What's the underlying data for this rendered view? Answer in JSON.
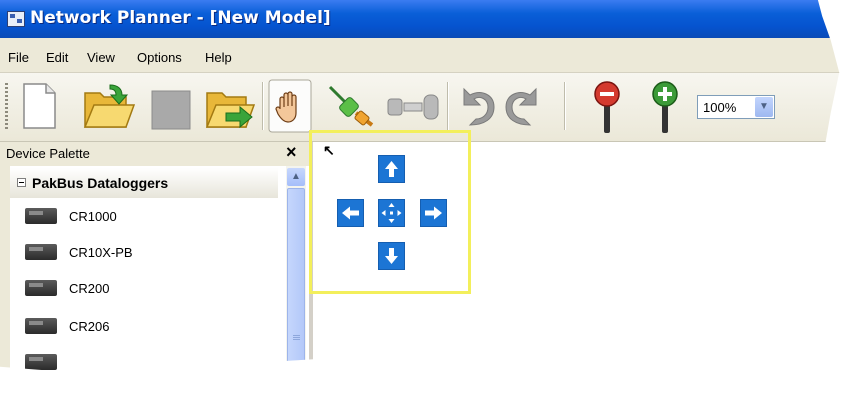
{
  "window": {
    "title": "Network Planner - [New Model]"
  },
  "menu": [
    "File",
    "Edit",
    "View",
    "Options",
    "Help"
  ],
  "toolbar": {
    "buttons": [
      {
        "name": "new-file-icon"
      },
      {
        "name": "open-folder-icon"
      },
      {
        "name": "save-icon"
      },
      {
        "name": "export-folder-icon"
      },
      {
        "name": "pan-hand-icon"
      },
      {
        "name": "connect-plug-icon"
      },
      {
        "name": "link-devices-icon"
      },
      {
        "name": "undo-icon"
      },
      {
        "name": "redo-icon"
      },
      {
        "name": "zoom-out-icon"
      },
      {
        "name": "zoom-in-icon"
      }
    ],
    "zoom": {
      "value": "100%"
    }
  },
  "palette": {
    "title": "Device Palette",
    "close_label": "×",
    "group": "PakBus Dataloggers",
    "devices": [
      {
        "label": "CR1000"
      },
      {
        "label": "CR10X-PB"
      },
      {
        "label": "CR200"
      },
      {
        "label": "CR206"
      }
    ]
  },
  "pan_control": {
    "buttons": [
      "pan-up",
      "pan-left",
      "pan-center",
      "pan-right",
      "pan-down"
    ]
  },
  "colors": {
    "titlebar": "#0553cf",
    "pan_button": "#1c75d4",
    "highlight": "#f3ef5b",
    "chrome": "#ece9d8"
  }
}
